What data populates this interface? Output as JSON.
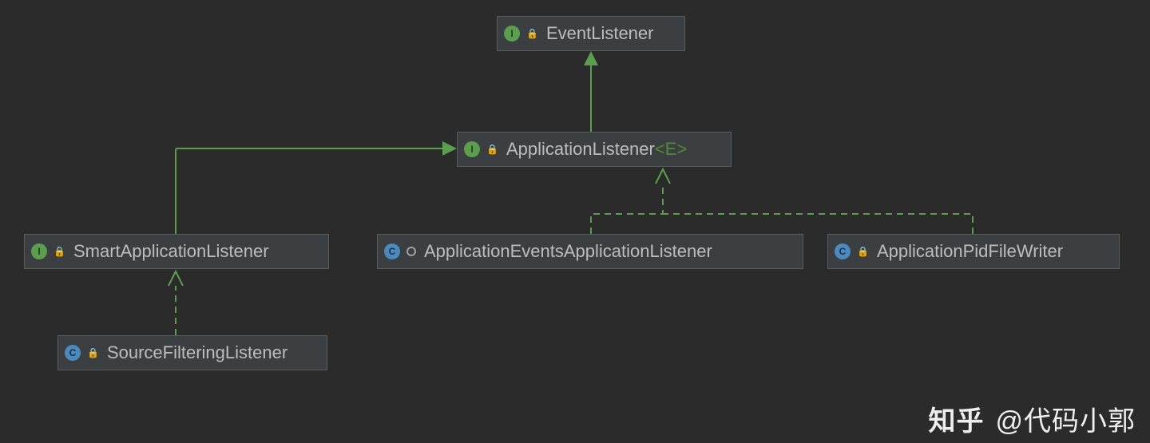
{
  "nodes": {
    "eventListener": {
      "kind": "interface",
      "modifier": "lock",
      "label": "EventListener"
    },
    "applicationListener": {
      "kind": "interface",
      "modifier": "lock",
      "label": "ApplicationListener",
      "generic": "<E>"
    },
    "smartApplicationListener": {
      "kind": "interface",
      "modifier": "lock",
      "label": "SmartApplicationListener"
    },
    "applicationEventsApplicationListener": {
      "kind": "class",
      "modifier": "ring",
      "label": "ApplicationEventsApplicationListener"
    },
    "applicationPidFileWriter": {
      "kind": "class",
      "modifier": "lock",
      "label": "ApplicationPidFileWriter"
    },
    "sourceFilteringListener": {
      "kind": "class",
      "modifier": "lock",
      "label": "SourceFilteringListener"
    }
  },
  "watermark": {
    "brand": "知乎",
    "author": "@代码小郭"
  }
}
